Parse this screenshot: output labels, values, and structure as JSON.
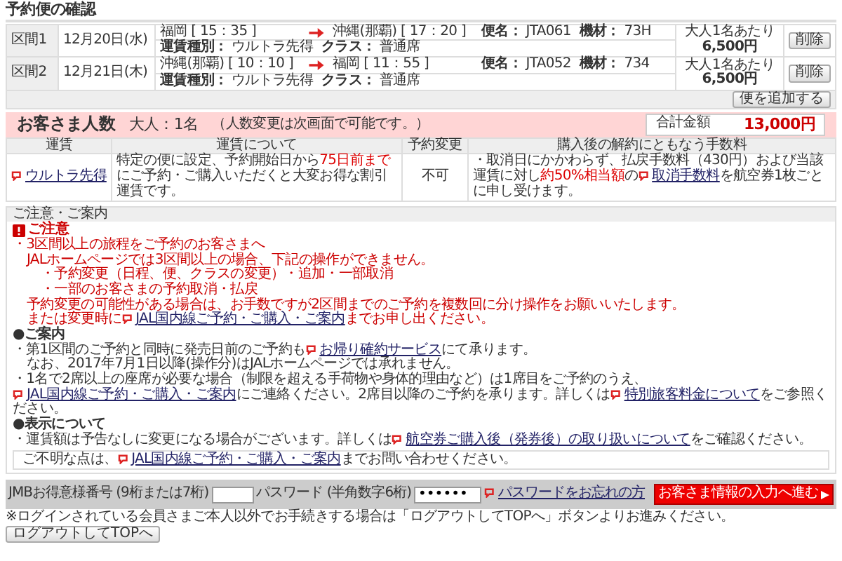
{
  "title": "予約便の確認",
  "segments": [
    {
      "label": "区間1",
      "date": "12月20日(水)",
      "from": "福岡 [ 15：35 ]",
      "to": "沖縄(那覇) [ 17：20 ]",
      "flight_label": "便名：",
      "flight": "JTA061",
      "aircraft_label": "機材：",
      "aircraft": "73H",
      "fare_type_label": "運賃種別：",
      "fare_type": "ウルトラ先得",
      "class_label": "クラス：",
      "class": "普通席",
      "price_label": "大人1名あたり",
      "price": "6,500円",
      "delete": "削除"
    },
    {
      "label": "区間2",
      "date": "12月21日(木)",
      "from": "沖縄(那覇) [ 10：10 ]",
      "to": "福岡 [ 11：55 ]",
      "flight_label": "便名：",
      "flight": "JTA052",
      "aircraft_label": "機材：",
      "aircraft": "734",
      "fare_type_label": "運賃種別：",
      "fare_type": "ウルトラ先得",
      "class_label": "クラス：",
      "class": "普通席",
      "price_label": "大人1名あたり",
      "price": "6,500円",
      "delete": "削除"
    }
  ],
  "add_button": "便を追加する",
  "passengers": {
    "heading": "お客さま人数",
    "count": "大人：1名",
    "note": "（人数変更は次画面で可能です。）",
    "total_label": "合計金額",
    "total": "13,000円"
  },
  "fare_table": {
    "columns": [
      "運賃",
      "運賃について",
      "予約変更",
      "購入後の解約にともなう手数料"
    ],
    "row": {
      "fare": "ウルトラ先得",
      "about": [
        {
          "kind": "text",
          "text": "特定の便に設定、予約開始日から"
        },
        {
          "kind": "red",
          "text": "75日前まで"
        },
        {
          "kind": "text",
          "text": "にご予約・ご購入いただくと大変お得な割引運賃です。"
        }
      ],
      "change": "不可",
      "fee": [
        {
          "kind": "text",
          "text": "・取消日にかかわらず、払戻手数料（430円）および当該運賃に対し"
        },
        {
          "kind": "red",
          "text": "約50%相当額"
        },
        {
          "kind": "text",
          "text": "の"
        },
        {
          "kind": "link",
          "text": "取消手数料"
        },
        {
          "kind": "text",
          "text": "を航空券1枚ごとに申し受けます。"
        }
      ]
    }
  },
  "notice": {
    "title": "ご注意・ご案内",
    "groups": [
      {
        "kind": "caution",
        "title": "ご注意",
        "items": [
          {
            "parts": [
              {
                "kind": "text",
                "text": "・3区間以上の旅程をご予約のお客さまへ"
              }
            ],
            "children": [
              {
                "parts": [
                  {
                    "kind": "text",
                    "text": "JALホームページでは3区間以上の場合、下記の操作ができません。"
                  }
                ],
                "children": [
                  {
                    "parts": [
                      {
                        "kind": "text",
                        "text": "・予約変更（日程、便、クラスの変更）・追加・一部取消"
                      }
                    ]
                  },
                  {
                    "parts": [
                      {
                        "kind": "text",
                        "text": "・一部のお客さまの予約取消・払戻"
                      }
                    ]
                  }
                ]
              },
              {
                "parts": [
                  {
                    "kind": "text",
                    "text": "予約変更の可能性がある場合は、お手数ですが2区間までのご予約を複数回に分け操作をお願いいたします。"
                  }
                ]
              },
              {
                "parts": [
                  {
                    "kind": "text",
                    "text": "または変更時に"
                  },
                  {
                    "kind": "link",
                    "text": "JAL国内線ご予約・ご購入・ご案内"
                  },
                  {
                    "kind": "text",
                    "text": "までお申し出ください。"
                  }
                ]
              }
            ]
          }
        ]
      },
      {
        "kind": "info",
        "title": "●ご案内",
        "items": [
          {
            "parts": [
              {
                "kind": "text",
                "text": "・第1区間のご予約と同時に発売日前のご予約も"
              },
              {
                "kind": "link",
                "text": "お帰り確約サービス"
              },
              {
                "kind": "text",
                "text": "にて承ります。"
              }
            ],
            "children": [
              {
                "parts": [
                  {
                    "kind": "text",
                    "text": "なお、2017年7月1日以降(操作分)はJALホームページでは承れません。"
                  }
                ]
              }
            ]
          },
          {
            "parts": [
              {
                "kind": "text",
                "text": "・1名で2席以上の座席が必要な場合（制限を超える手荷物や身体的理由など）は1席目をご予約のうえ、"
              },
              {
                "kind": "link",
                "text": "JAL国内線ご予約・ご購入・ご案内"
              },
              {
                "kind": "text",
                "text": "にご連絡ください。2席目以降のご予約を承ります。詳しくは"
              },
              {
                "kind": "link",
                "text": "特別旅客料金について"
              },
              {
                "kind": "text",
                "text": "をご参照ください。"
              }
            ]
          }
        ]
      },
      {
        "kind": "info",
        "title": "●表示について",
        "items": [
          {
            "parts": [
              {
                "kind": "text",
                "text": "・運賃額は予告なしに変更になる場合がございます。詳しくは"
              },
              {
                "kind": "link",
                "text": "航空券ご購入後（発券後）の取り扱いについて"
              },
              {
                "kind": "text",
                "text": "をご確認ください。"
              }
            ]
          }
        ]
      }
    ],
    "inquiry": [
      {
        "kind": "text",
        "text": "ご不明な点は、"
      },
      {
        "kind": "link",
        "text": "JAL国内線ご予約・ご購入・ご案内"
      },
      {
        "kind": "text",
        "text": "までお問い合わせください。"
      }
    ]
  },
  "login": {
    "member_label": "JMBお得意様番号 (9桁または7桁)",
    "password_label": "パスワード (半角数字6桁)",
    "password_value": "••••••",
    "forgot_link": "パスワードをお忘れの方",
    "proceed_button": "お客さま情報の入力へ進む"
  },
  "footer_note": "※ログインされている会員さまご本人以外でお手続きする場合は「ログアウトしてTOPへ」ボタンよりお進みください。",
  "logout_button": "ログアウトしてTOPへ"
}
